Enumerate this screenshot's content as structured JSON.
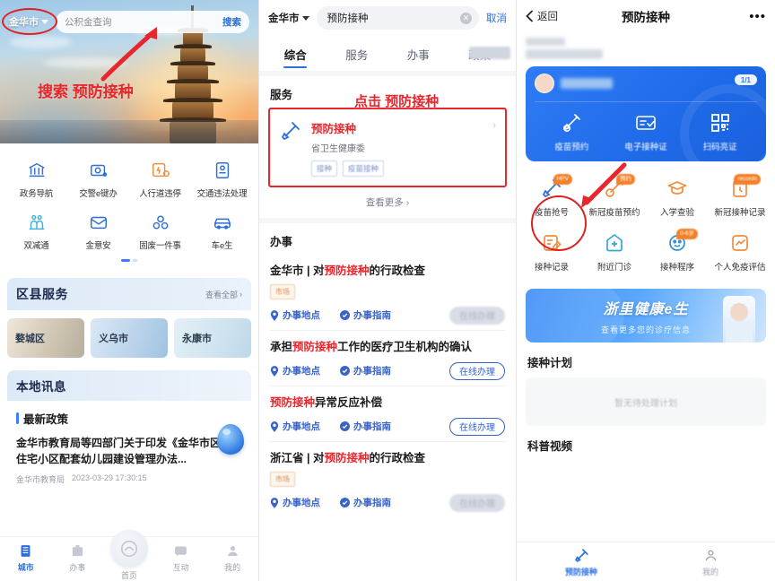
{
  "left": {
    "city": "金华市",
    "search_placeholder": "公积金查询",
    "search_button": "搜索",
    "annotation": "搜索 预防接种",
    "apps": [
      {
        "label": "政务导航",
        "icon": "bank-icon"
      },
      {
        "label": "交警e键办",
        "icon": "police-camera-icon"
      },
      {
        "label": "人行道违停",
        "icon": "pedestrian-parking-icon"
      },
      {
        "label": "交通违法处理",
        "icon": "traffic-ticket-icon"
      },
      {
        "label": "双减通",
        "icon": "education-icon"
      },
      {
        "label": "金意安",
        "icon": "envelope-icon"
      },
      {
        "label": "固废一件事",
        "icon": "waste-icon"
      },
      {
        "label": "车e生",
        "icon": "car-icon"
      }
    ],
    "district": {
      "title": "区县服务",
      "more": "查看全部",
      "items": [
        {
          "name": "婺城区"
        },
        {
          "name": "义乌市"
        },
        {
          "name": "永康市"
        }
      ]
    },
    "news": {
      "section_title": "本地讯息",
      "policy_label": "最新政策",
      "headline": "金华市教育局等四部门关于印发《金华市区城镇住宅小区配套幼儿园建设管理办法...",
      "source": "金华市教育局",
      "time": "2023-03-29 17:30:15"
    },
    "tabbar": [
      {
        "label": "城市",
        "icon": "city-icon",
        "active": true
      },
      {
        "label": "办事",
        "icon": "briefcase-icon",
        "active": false
      },
      {
        "label": "首页",
        "icon": "home-icon",
        "active": false
      },
      {
        "label": "互动",
        "icon": "chat-icon",
        "active": false
      },
      {
        "label": "我的",
        "icon": "person-icon",
        "active": false
      }
    ]
  },
  "mid": {
    "city": "金华市",
    "query": "预防接种",
    "cancel": "取消",
    "tabs": [
      {
        "label": "综合",
        "active": true
      },
      {
        "label": "服务",
        "active": false
      },
      {
        "label": "办事",
        "active": false
      },
      {
        "label": "政策",
        "active": false
      }
    ],
    "service_section_title": "服务",
    "annotation": "点击 预防接种",
    "service_card": {
      "name": "预防接种",
      "org": "省卫生健康委",
      "tags": [
        "接种",
        "疫苗接种"
      ],
      "icon": "syringe-icon"
    },
    "more_link": "查看更多 ›",
    "do_section_title": "办事",
    "do_items": [
      {
        "prefix": "金华市 | 对",
        "highlight": "预防接种",
        "suffix": "的行政检查",
        "badge": "市场",
        "links": [
          "办事地点",
          "办事指南"
        ],
        "button": "在线办理",
        "button_style": "blurred"
      },
      {
        "prefix": "承担",
        "highlight": "预防接种",
        "suffix": "工作的医疗卫生机构的确认",
        "badge": "",
        "links": [
          "办事地点",
          "办事指南"
        ],
        "button": "在线办理",
        "button_style": "outline"
      },
      {
        "prefix": "",
        "highlight": "预防接种",
        "suffix": "异常反应补偿",
        "badge": "",
        "links": [
          "办事地点",
          "办事指南"
        ],
        "button": "在线办理",
        "button_style": "outline"
      },
      {
        "prefix": "浙江省 | 对",
        "highlight": "预防接种",
        "suffix": "的行政检查",
        "badge": "市场",
        "links": [
          "办事地点",
          "办事指南"
        ],
        "button": "在线办理",
        "button_style": "blurred"
      }
    ]
  },
  "right": {
    "back": "返回",
    "title": "预防接种",
    "menu": "•••",
    "card": {
      "count": "1/1",
      "actions": [
        {
          "label": "疫苗预约",
          "icon": "vaccine-booking-icon"
        },
        {
          "label": "电子接种证",
          "icon": "certificate-icon"
        },
        {
          "label": "扫码亮证",
          "icon": "qr-code-icon"
        }
      ]
    },
    "grid": [
      {
        "label": "疫苗抢号",
        "badge": "HPV",
        "icon": "syringe-icon"
      },
      {
        "label": "新冠疫苗预约",
        "badge": "预约",
        "icon": "vaccine-booking-icon"
      },
      {
        "label": "入学查验",
        "badge": "",
        "icon": "graduation-cap-icon"
      },
      {
        "label": "新冠接种记录",
        "badge": "records",
        "icon": "clipboard-icon"
      },
      {
        "label": "接种记录",
        "badge": "",
        "icon": "edit-doc-icon"
      },
      {
        "label": "附近门诊",
        "badge": "",
        "icon": "clinic-icon"
      },
      {
        "label": "接种程序",
        "badge": "0-6岁",
        "icon": "baby-face-icon"
      },
      {
        "label": "个人免疫评估",
        "badge": "",
        "icon": "chart-icon"
      }
    ],
    "banner": {
      "title": "浙里健康e生",
      "subtitle": "查看更多您的诊疗信息"
    },
    "plan_section": "接种计划",
    "plan_empty": "暂无待处理计划",
    "video_section": "科普视频",
    "tabbar": [
      {
        "label": "预防接种",
        "icon": "syringe-icon",
        "active": true
      },
      {
        "label": "我的",
        "icon": "person-icon",
        "active": false
      }
    ]
  },
  "colors": {
    "accent": "#2b6fe0",
    "annotation": "#e8262c",
    "orange": "#f4802a"
  }
}
